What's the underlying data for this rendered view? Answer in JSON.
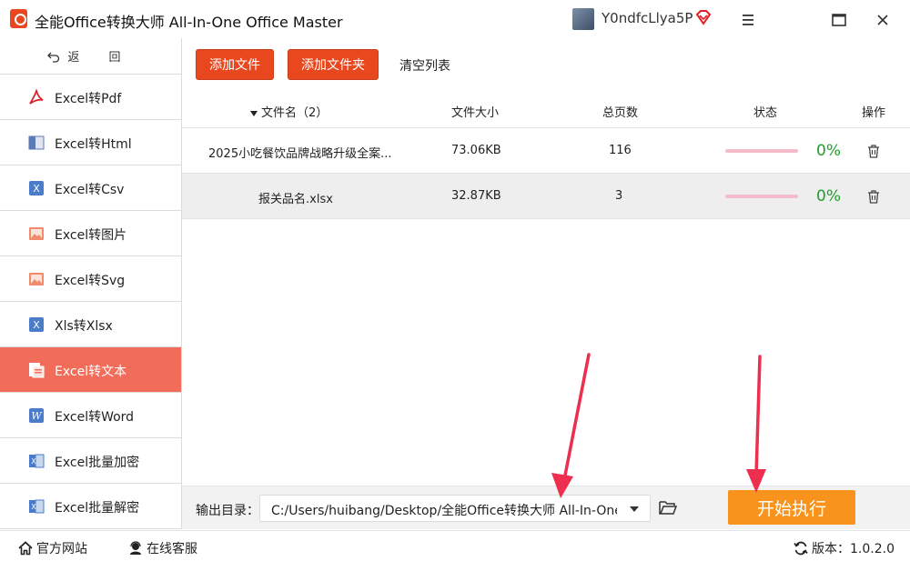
{
  "app": {
    "title": "全能Office转换大师 All-In-One Office Master",
    "user_name": "Y0ndfcLlya5P"
  },
  "sidebar": {
    "back_label": "返  回",
    "items": [
      {
        "label": "Excel转Pdf",
        "icon": "pdf-icon"
      },
      {
        "label": "Excel转Html",
        "icon": "html-icon"
      },
      {
        "label": "Excel转Csv",
        "icon": "csv-icon"
      },
      {
        "label": "Excel转图片",
        "icon": "image-icon"
      },
      {
        "label": "Excel转Svg",
        "icon": "svg-image-icon"
      },
      {
        "label": "Xls转Xlsx",
        "icon": "xls-icon"
      },
      {
        "label": "Excel转文本",
        "icon": "text-doc-icon",
        "active": true
      },
      {
        "label": "Excel转Word",
        "icon": "word-icon"
      },
      {
        "label": "Excel批量加密",
        "icon": "excel-lock-icon"
      },
      {
        "label": "Excel批量解密",
        "icon": "excel-unlock-icon"
      }
    ]
  },
  "toolbar": {
    "add_file": "添加文件",
    "add_folder": "添加文件夹",
    "clear_list": "清空列表"
  },
  "table": {
    "headers": {
      "name": "文件名（2）",
      "size": "文件大小",
      "pages": "总页数",
      "status": "状态",
      "action": "操作"
    },
    "rows": [
      {
        "name": "2025小吃餐饮品牌战略升级全案...",
        "size": "73.06KB",
        "pages": "116",
        "progress": "0%"
      },
      {
        "name": "报关品名.xlsx",
        "size": "32.87KB",
        "pages": "3",
        "progress": "0%"
      }
    ]
  },
  "output": {
    "label": "输出目录：",
    "path": "C:/Users/huibang/Desktop/全能Office转换大师 All-In-One Office Master",
    "start_label": "开始执行"
  },
  "statusbar": {
    "website": "官方网站",
    "support": "在线客服",
    "version": "版本：1.0.2.0"
  },
  "colors": {
    "accent_red": "#e9481f",
    "active_item": "#f26c5a",
    "start_orange": "#f8941d",
    "progress_green": "#1e9e2a"
  }
}
